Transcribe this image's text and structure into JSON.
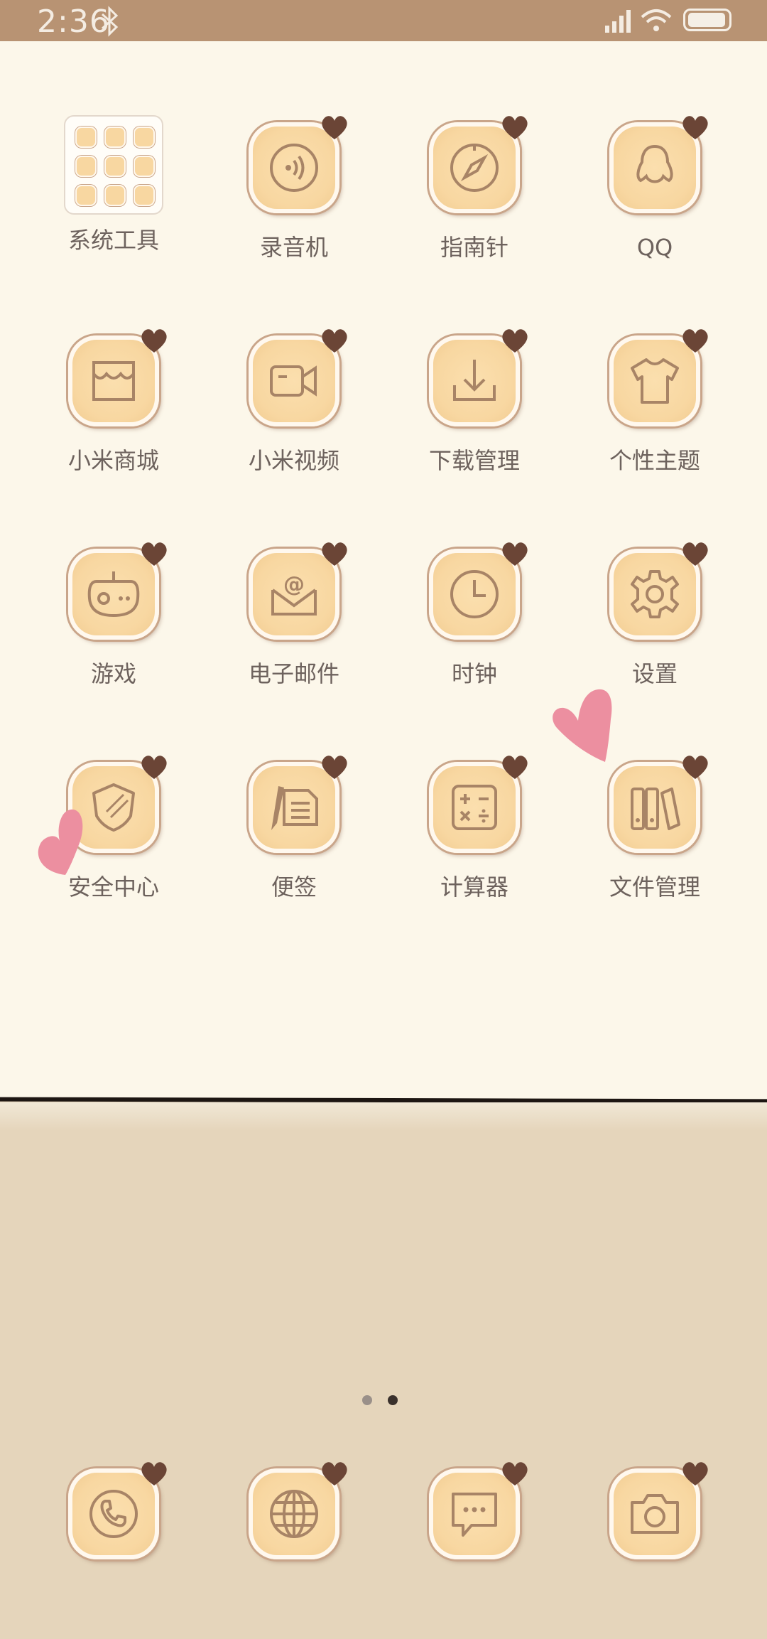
{
  "status_bar": {
    "time": "2:36"
  },
  "home_grid": [
    {
      "label": "系统工具",
      "icon": "folder-icon"
    },
    {
      "label": "录音机",
      "icon": "recorder-icon"
    },
    {
      "label": "指南针",
      "icon": "compass-icon"
    },
    {
      "label": "QQ",
      "icon": "qq-penguin-icon"
    },
    {
      "label": "小米商城",
      "icon": "store-icon"
    },
    {
      "label": "小米视频",
      "icon": "video-icon"
    },
    {
      "label": "下载管理",
      "icon": "download-icon"
    },
    {
      "label": "个性主题",
      "icon": "theme-shirt-icon"
    },
    {
      "label": "游戏",
      "icon": "game-icon"
    },
    {
      "label": "电子邮件",
      "icon": "email-icon"
    },
    {
      "label": "时钟",
      "icon": "clock-icon"
    },
    {
      "label": "设置",
      "icon": "gear-icon"
    },
    {
      "label": "安全中心",
      "icon": "shield-icon"
    },
    {
      "label": "便签",
      "icon": "notes-icon"
    },
    {
      "label": "计算器",
      "icon": "calculator-icon"
    },
    {
      "label": "文件管理",
      "icon": "files-icon"
    }
  ],
  "page_indicator": {
    "current": 2,
    "total": 2
  },
  "dock": [
    {
      "icon": "phone-icon"
    },
    {
      "icon": "browser-globe-icon"
    },
    {
      "icon": "messages-icon"
    },
    {
      "icon": "camera-icon"
    }
  ],
  "colors": {
    "status_bar": "#b89373",
    "paper": "#fcf7ea",
    "wallpaper": "#e5d5bb",
    "icon_fill": "#f8d7a1",
    "icon_line": "#a88466",
    "heart_brown": "#6b4536",
    "heart_pink": "#ec8fa0",
    "label": "#6d625d"
  }
}
